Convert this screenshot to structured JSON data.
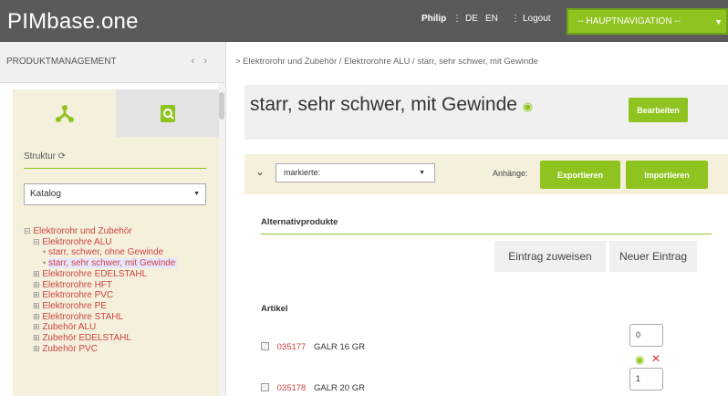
{
  "app": {
    "title": "PIMbase.one"
  },
  "topbar": {
    "user": "Philip",
    "lang_de": "DE",
    "lang_en": "EN",
    "logout": "Logout",
    "nav_select": "-- HAUPTNAVIGATION --"
  },
  "sidebar": {
    "header": "PRODUKTMANAGEMENT",
    "struktur_label": "Struktur",
    "katalog_select": "Katalog",
    "tree": [
      {
        "label": "Elektrorohr und Zubehör",
        "mark": "⊟",
        "level": 0
      },
      {
        "label": "Elektrorohre ALU",
        "mark": "⊟",
        "level": 1
      },
      {
        "label": "starr, schwer, ohne Gewinde",
        "mark": "•",
        "level": 2
      },
      {
        "label": "starr, sehr schwer, mit Gewinde",
        "mark": "•",
        "level": 2,
        "selected": true
      },
      {
        "label": "Elektrorohre EDELSTAHL",
        "mark": "⊞",
        "level": 1
      },
      {
        "label": "Elektrorohre HFT",
        "mark": "⊞",
        "level": 1
      },
      {
        "label": "Elektrorohre PVC",
        "mark": "⊞",
        "level": 1
      },
      {
        "label": "Elektrorohre PE",
        "mark": "⊞",
        "level": 1
      },
      {
        "label": "Elektrorohre STAHL",
        "mark": "⊞",
        "level": 1
      },
      {
        "label": "Zubehör ALU",
        "mark": "⊞",
        "level": 1
      },
      {
        "label": "Zubehör EDELSTAHL",
        "mark": "⊞",
        "level": 1
      },
      {
        "label": "Zubehör PVC",
        "mark": "⊞",
        "level": 1
      }
    ]
  },
  "main": {
    "breadcrumb": "> Elektrorohr und Zubehör / Elektrorohre ALU / starr, sehr schwer, mit Gewinde",
    "title": "starr, sehr schwer, mit Gewinde",
    "edit_button": "Bearbeiten",
    "marked_select": "markierte:",
    "attachments_label": "Anhänge:",
    "export_button": "Exportieren",
    "import_button": "Importieren",
    "alternatives_title": "Alternativprodukte",
    "assign_button": "Eintrag zuweisen",
    "new_entry_button": "Neuer Eintrag",
    "articles_title": "Artikel",
    "articles": [
      {
        "code": "035177",
        "name": "GALR 16 GR",
        "qty": "0"
      },
      {
        "code": "035178",
        "name": "GALR 20 GR",
        "qty": "1"
      }
    ]
  },
  "colors": {
    "accent": "#8fc31f",
    "topbar": "#5a5a5a",
    "panel": "#f4f0dc"
  }
}
